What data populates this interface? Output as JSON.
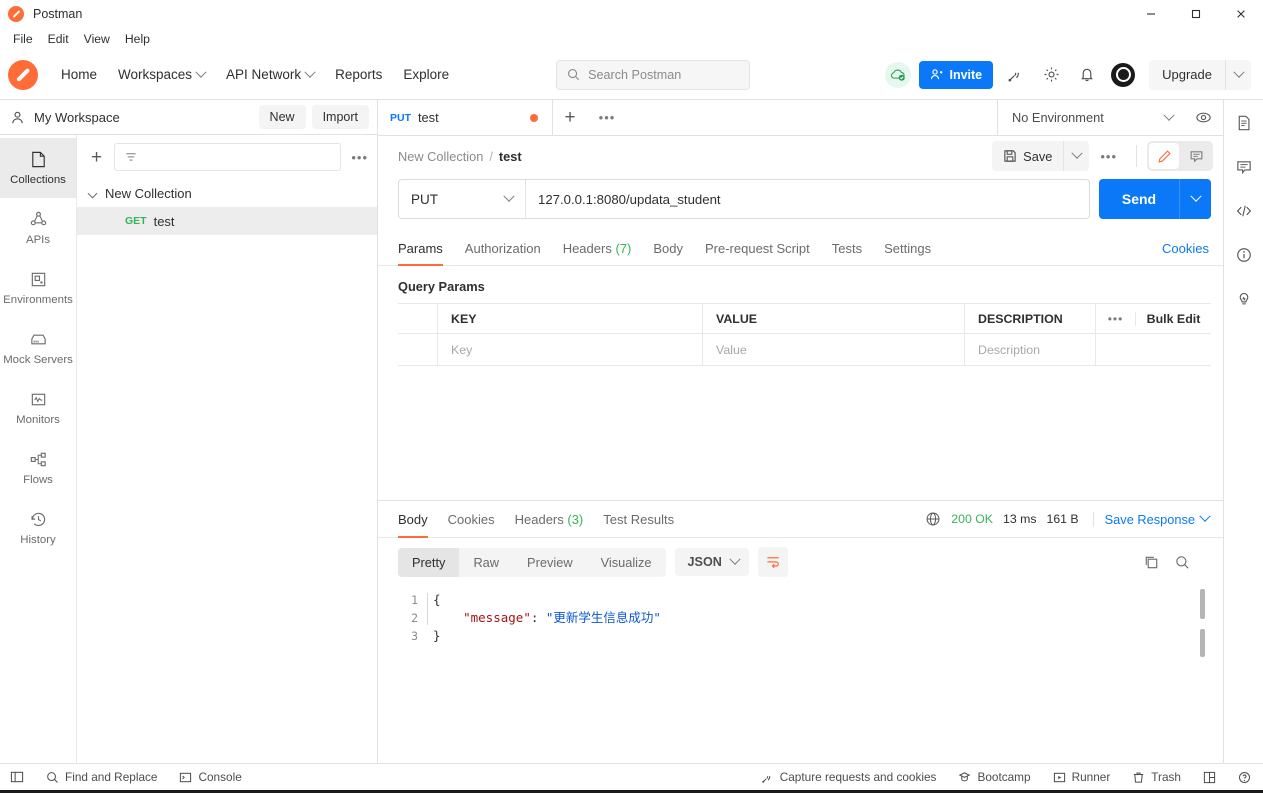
{
  "window": {
    "title": "Postman",
    "controls": {
      "minimize": "minimize-icon",
      "maximize": "maximize-icon",
      "close": "close-icon"
    }
  },
  "menubar": {
    "items": [
      "File",
      "Edit",
      "View",
      "Help"
    ]
  },
  "header": {
    "nav": [
      {
        "label": "Home",
        "caret": false
      },
      {
        "label": "Workspaces",
        "caret": true
      },
      {
        "label": "API Network",
        "caret": true
      },
      {
        "label": "Reports",
        "caret": false
      },
      {
        "label": "Explore",
        "caret": false
      }
    ],
    "search": {
      "placeholder": "Search Postman",
      "icon": "search-icon"
    },
    "invite_label": "Invite",
    "upgrade_label": "Upgrade",
    "icons": [
      "cloud-check-icon",
      "satellite-icon",
      "gear-icon",
      "bell-icon",
      "account-icon"
    ]
  },
  "workspace": {
    "name": "My Workspace",
    "new_label": "New",
    "import_label": "Import"
  },
  "sidebar": {
    "items": [
      {
        "label": "Collections",
        "icon": "collections-icon",
        "active": true
      },
      {
        "label": "APIs",
        "icon": "apis-icon",
        "active": false
      },
      {
        "label": "Environments",
        "icon": "environments-icon",
        "active": false
      },
      {
        "label": "Mock Servers",
        "icon": "mock-servers-icon",
        "active": false
      },
      {
        "label": "Monitors",
        "icon": "monitors-icon",
        "active": false
      },
      {
        "label": "Flows",
        "icon": "flows-icon",
        "active": false
      },
      {
        "label": "History",
        "icon": "history-icon",
        "active": false
      }
    ]
  },
  "tree": {
    "filter_placeholder": "",
    "collection_name": "New Collection",
    "request": {
      "method": "GET",
      "name": "test"
    }
  },
  "tabs": {
    "open": [
      {
        "method": "PUT",
        "name": "test",
        "unsaved": true
      }
    ],
    "environment": "No Environment"
  },
  "breadcrumb": {
    "collection": "New Collection",
    "separator": "/",
    "current": "test"
  },
  "actions": {
    "save_label": "Save"
  },
  "request": {
    "method": "PUT",
    "url": "127.0.0.1:8080/updata_student",
    "send_label": "Send",
    "tabs": [
      {
        "label": "Params",
        "active": true
      },
      {
        "label": "Authorization",
        "active": false
      },
      {
        "label": "Headers",
        "count": "(7)",
        "active": false
      },
      {
        "label": "Body",
        "active": false
      },
      {
        "label": "Pre-request Script",
        "active": false
      },
      {
        "label": "Tests",
        "active": false
      },
      {
        "label": "Settings",
        "active": false
      }
    ],
    "cookies_label": "Cookies"
  },
  "query_params": {
    "title": "Query Params",
    "columns": [
      "KEY",
      "VALUE",
      "DESCRIPTION"
    ],
    "bulk_edit_label": "Bulk Edit",
    "placeholder_row": {
      "key": "Key",
      "value": "Value",
      "description": "Description"
    }
  },
  "response": {
    "tabs": [
      {
        "label": "Body",
        "active": true
      },
      {
        "label": "Cookies",
        "active": false
      },
      {
        "label": "Headers",
        "count": "(3)",
        "active": false
      },
      {
        "label": "Test Results",
        "active": false
      }
    ],
    "status": "200 OK",
    "time": "13 ms",
    "size": "161 B",
    "save_response_label": "Save Response",
    "formats": [
      {
        "label": "Pretty",
        "active": true
      },
      {
        "label": "Raw",
        "active": false
      },
      {
        "label": "Preview",
        "active": false
      },
      {
        "label": "Visualize",
        "active": false
      }
    ],
    "language": "JSON",
    "body_lines": [
      {
        "num": "1",
        "text": "{",
        "type": "plain"
      },
      {
        "num": "2",
        "key": "\"message\"",
        "colon": ": ",
        "value": "\"更新学生信息成功\"",
        "type": "pair",
        "indent": "    "
      },
      {
        "num": "3",
        "text": "}",
        "type": "plain"
      }
    ]
  },
  "right_rail": {
    "items": [
      "documentation-icon",
      "comments-icon",
      "code-icon",
      "info-icon",
      "lightbulb-icon"
    ]
  },
  "footer": {
    "left": [
      {
        "label": "",
        "icon": "sidebar-toggle-icon"
      },
      {
        "label": "Find and Replace",
        "icon": "search-icon"
      },
      {
        "label": "Console",
        "icon": "console-icon"
      }
    ],
    "right": [
      {
        "label": "Capture requests and cookies",
        "icon": "satellite-icon"
      },
      {
        "label": "Bootcamp",
        "icon": "bootcamp-icon"
      },
      {
        "label": "Runner",
        "icon": "runner-icon"
      },
      {
        "label": "Trash",
        "icon": "trash-icon"
      },
      {
        "label": "",
        "icon": "layout-icon"
      },
      {
        "label": "",
        "icon": "help-icon"
      }
    ]
  },
  "colors": {
    "accent_orange": "#ff6c37",
    "accent_blue": "#0b79f7",
    "success_green": "#35b558",
    "json_key": "#a31515",
    "json_value": "#0b57d0"
  }
}
